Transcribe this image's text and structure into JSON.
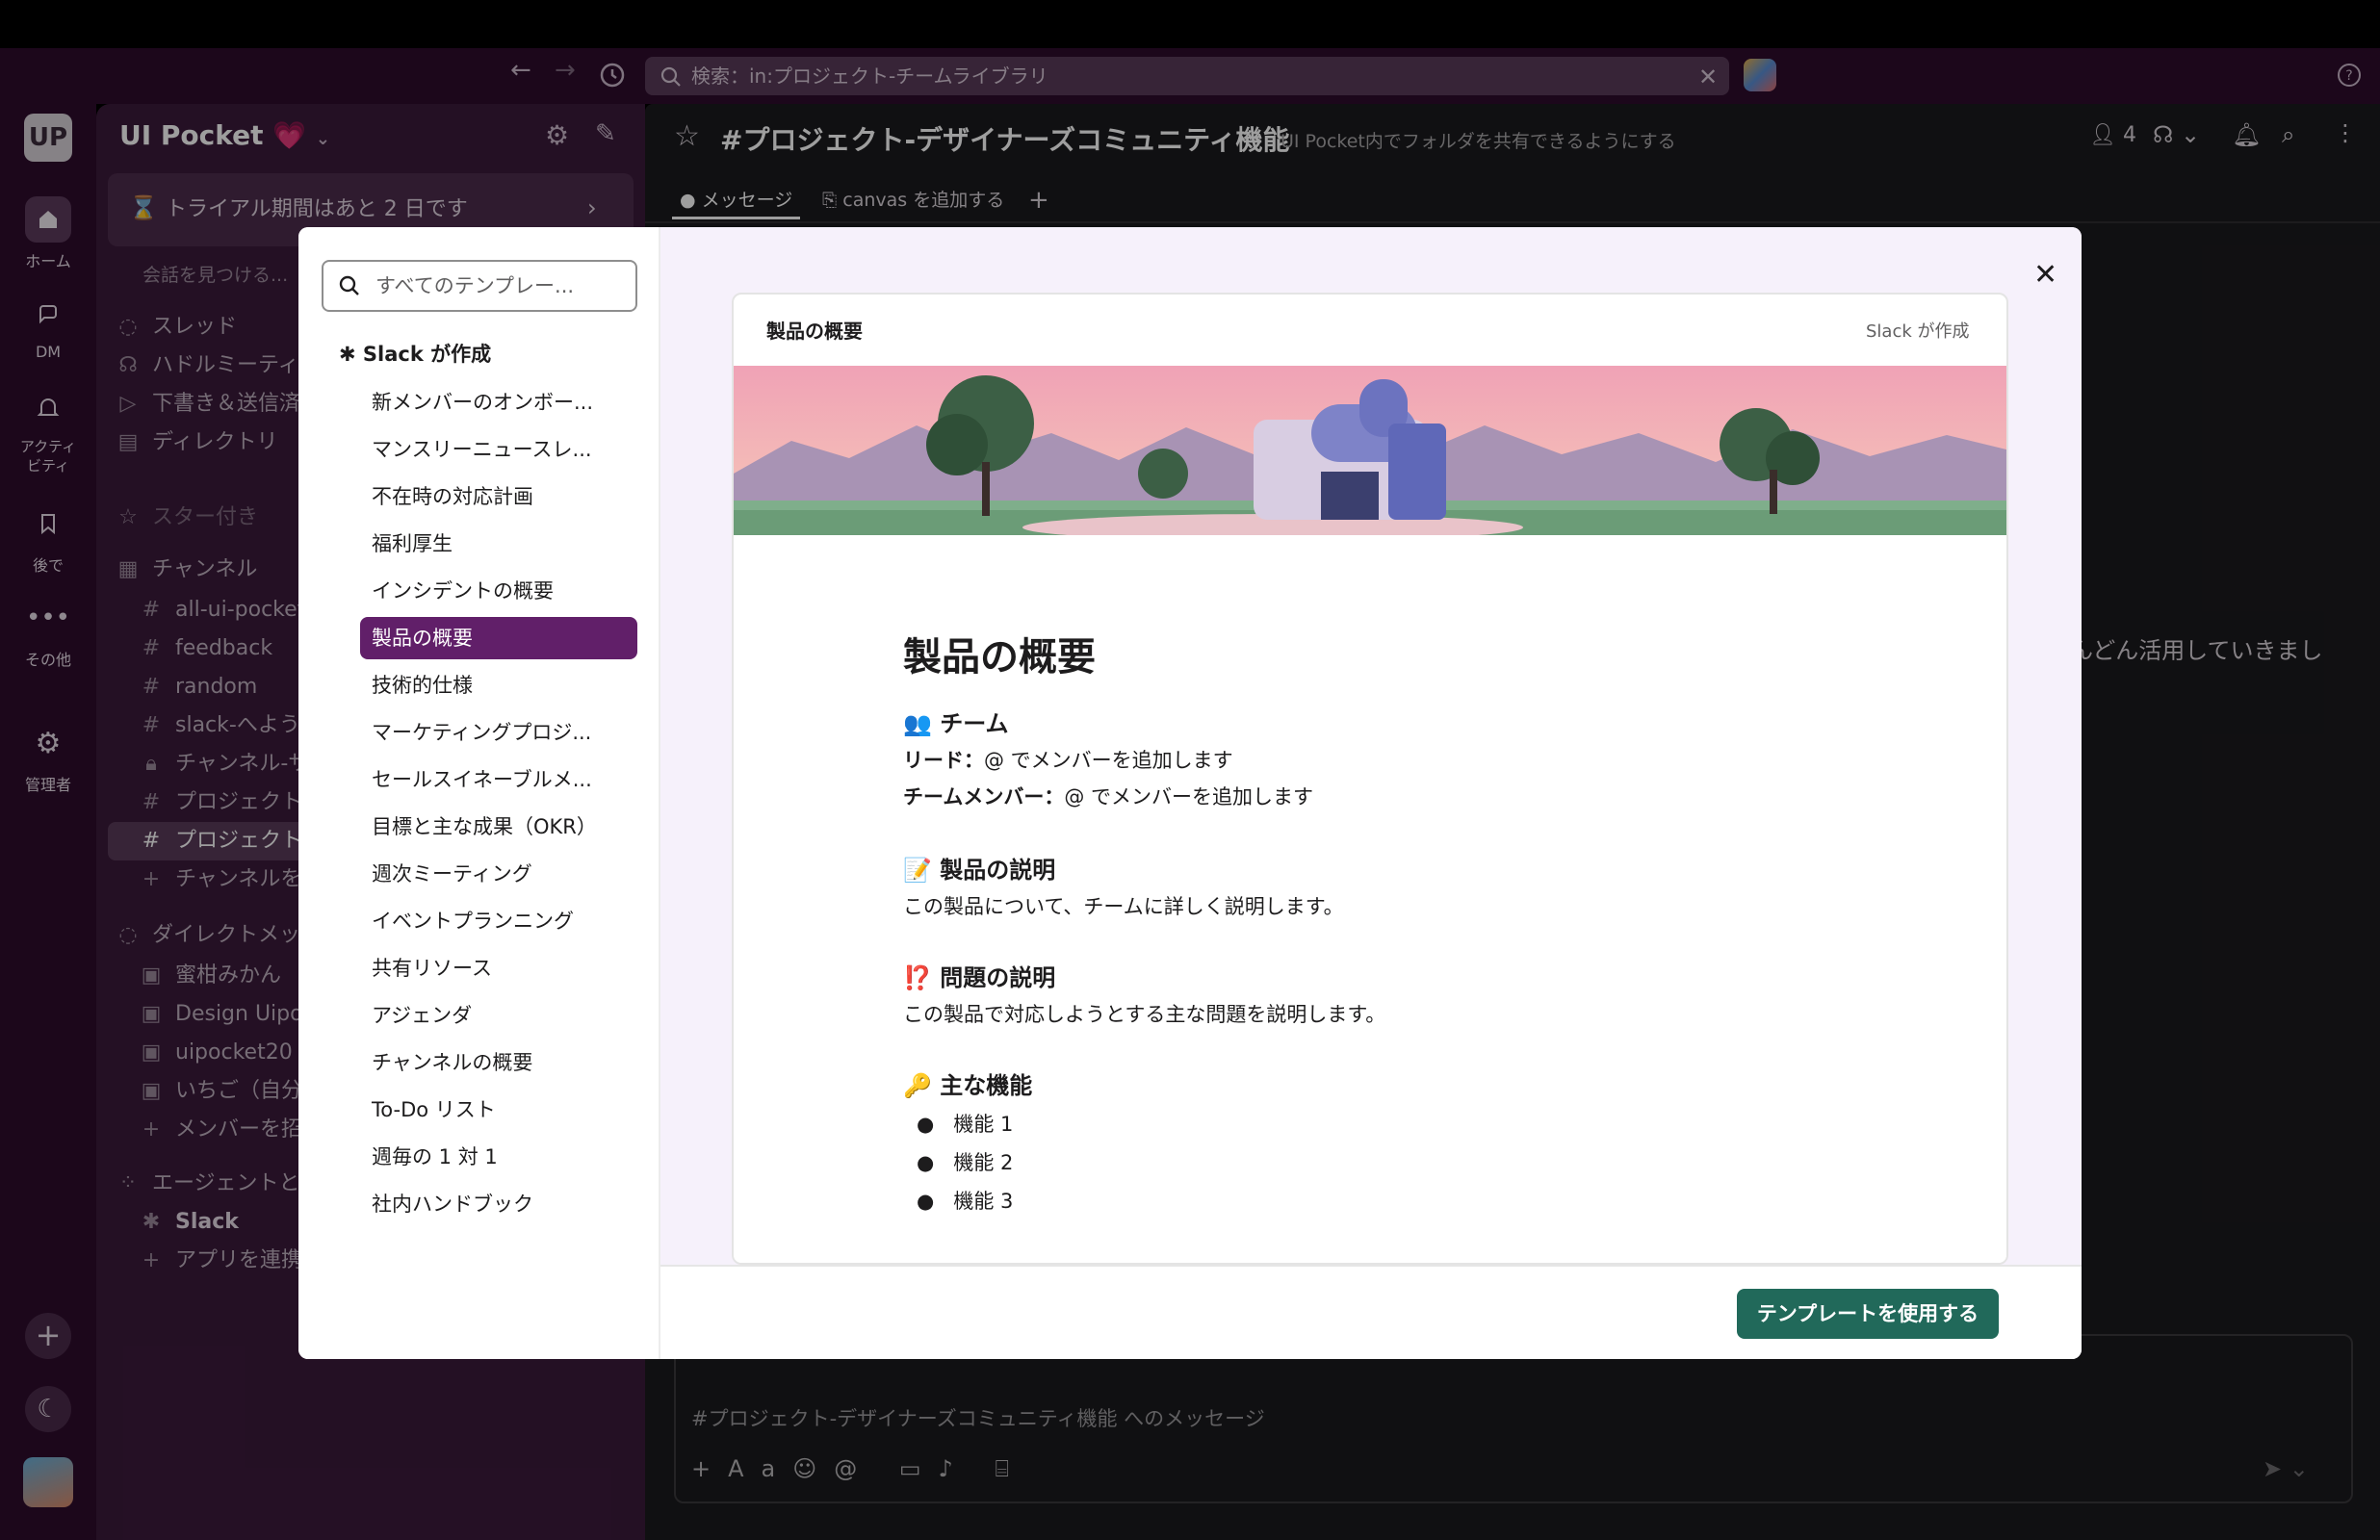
{
  "topbar": {
    "search_text": "検索：in:プロジェクト-チームライブラリ"
  },
  "rail": {
    "workspace_initials": "UP",
    "items": [
      {
        "label": "ホーム",
        "icon": "home-icon"
      },
      {
        "label": "DM",
        "icon": "dm-icon"
      },
      {
        "label": "アクティビティ",
        "icon": "bell-icon"
      },
      {
        "label": "後で",
        "icon": "bookmark-icon"
      },
      {
        "label": "その他",
        "icon": "more-icon"
      },
      {
        "label": "管理者",
        "icon": "gear-icon"
      }
    ]
  },
  "sidebar": {
    "workspace_name": "UI Pocket 💗",
    "trial_text": "トライアル期間はあと 2 日です",
    "find_placeholder": "会話を見つける...",
    "nav": [
      "スレッド",
      "ハドルミーティ",
      "下書き＆送信済",
      "ディレクトリ"
    ],
    "starred": "スター付き",
    "channels_header": "チャンネル",
    "channels": [
      "all-ui-pocket",
      "feedback",
      "random",
      "slack-へようこ",
      "チャンネル-サ",
      "プロジェクト",
      "プロジェクト"
    ],
    "add_channel": "チャンネルを",
    "dm_header": "ダイレクトメッ",
    "dms": [
      "蜜柑みかん",
      "Design Uipoc",
      "uipocket20",
      "いちご（自分"
    ],
    "add_member": "メンバーを招",
    "agents_header": "エージェントと",
    "agents": [
      "Slack"
    ],
    "add_app": "アプリを連携"
  },
  "channel": {
    "name": "#プロジェクト-デザイナーズコミュニティ機能",
    "topic": "UI Pocket内でフォルダを共有できるようにする",
    "member_count": "4",
    "tabs": [
      "メッセージ",
      "canvas を追加する"
    ],
    "background_text": "んどん活用していきまし",
    "composer_placeholder": "#プロジェクト-デザイナーズコミュニティ機能 へのメッセージ"
  },
  "modal": {
    "search_placeholder": "すべてのテンプレー...",
    "group_label": "Slack が作成",
    "templates": [
      "新メンバーのオンボー...",
      "マンスリーニュースレ...",
      "不在時の対応計画",
      "福利厚生",
      "インシデントの概要",
      "製品の概要",
      "技術的仕様",
      "マーケティングプロジ...",
      "セールスイネーブルメ...",
      "目標と主な成果（OKR）",
      "週次ミーティング",
      "イベントプランニング",
      "共有リソース",
      "アジェンダ",
      "チャンネルの概要",
      "To-Do リスト",
      "週毎の 1 対 1",
      "社内ハンドブック"
    ],
    "selected_index": 5,
    "use_button": "テンプレートを使用する",
    "preview": {
      "header_title": "製品の概要",
      "header_author": "Slack が作成",
      "doc_title": "製品の概要",
      "team_heading": "👥 チーム",
      "lead_label": "リード：",
      "lead_value": "@ でメンバーを追加します",
      "members_label": "チームメンバー：",
      "members_value": "@ でメンバーを追加します",
      "desc_heading": "📝 製品の説明",
      "desc_text": "この製品について、チームに詳しく説明します。",
      "problem_heading": "⁉️ 問題の説明",
      "problem_text": "この製品で対応しようとする主な問題を説明します。",
      "features_heading": "🔑 主な機能",
      "features": [
        "機能 1",
        "機能 2",
        "機能 3"
      ]
    }
  },
  "colors": {
    "aubergine": "#611f69",
    "green": "#21695a"
  }
}
